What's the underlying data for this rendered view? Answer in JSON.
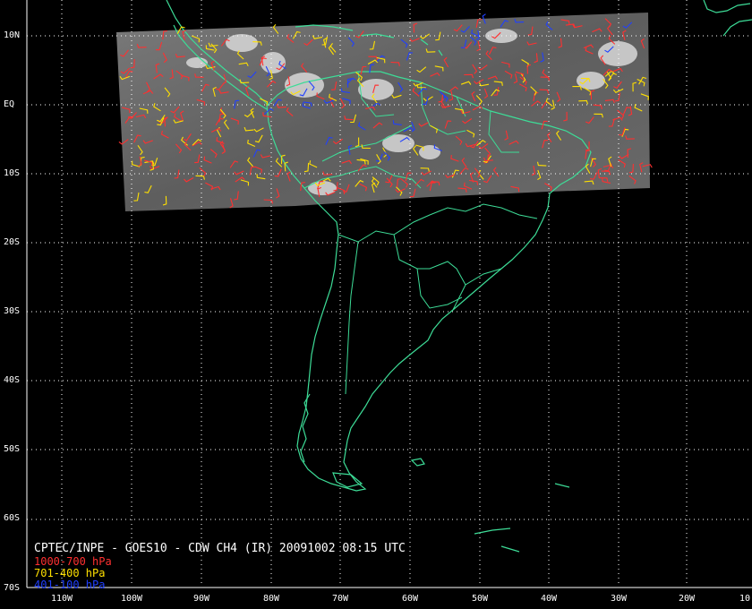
{
  "map": {
    "caption": "CPTEC/INPE - GOES10 - CDW CH4 (IR) 20091002 08:15 UTC",
    "legend": [
      {
        "label": "1000-700 hPa",
        "color": "#ff3030"
      },
      {
        "label": "701-400 hPa",
        "color": "#ffe000"
      },
      {
        "label": "401-100 hPa",
        "color": "#2040ff"
      }
    ],
    "lat_labels": [
      "10N",
      "EQ",
      "10S",
      "20S",
      "30S",
      "40S",
      "50S",
      "60S",
      "70S"
    ],
    "lon_labels": [
      "110W",
      "100W",
      "90W",
      "80W",
      "70W",
      "60W",
      "50W",
      "40W",
      "30W",
      "20W",
      "10"
    ],
    "coast_color": "#3ddc97",
    "grid_color": "#ffffff"
  }
}
